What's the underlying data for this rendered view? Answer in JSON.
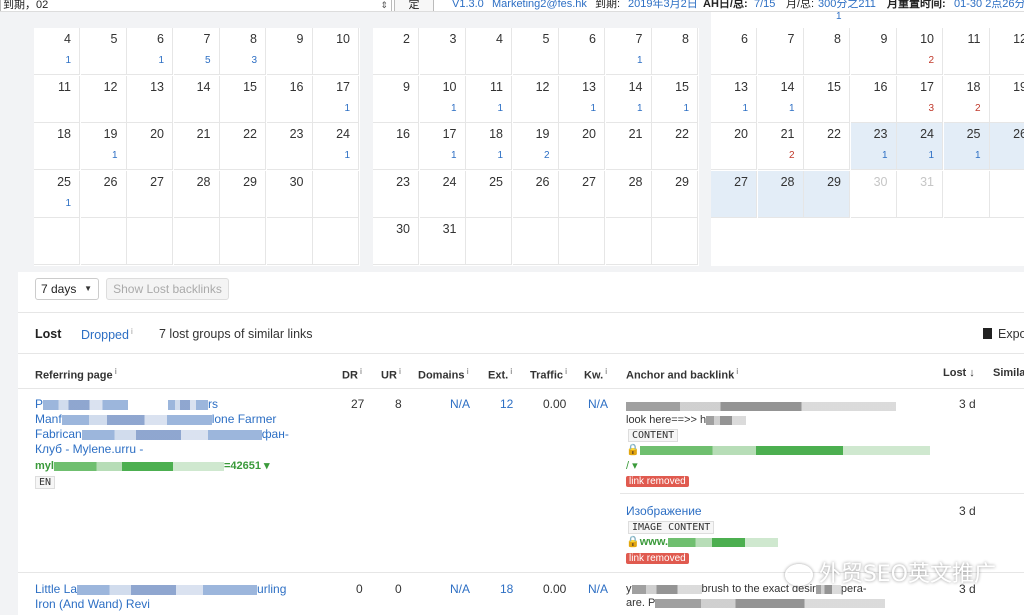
{
  "topbar": {
    "select_value": "到期，02",
    "confirm": "定",
    "version": "V1.3.0",
    "account": "Marketing2@fes.hk",
    "expire_label": "到期:",
    "expire_value": "2019年3月2日",
    "ah_label": "AH日/总:",
    "ah_value": "7/15",
    "month_label": "月/总:",
    "month_value": "300分之211",
    "reset_label": "月重置时间:",
    "reset_value": "01-30 2点26分"
  },
  "cal1": {
    "rows": [
      [
        {
          "d": "4",
          "c": "1"
        },
        {
          "d": "5",
          "c": ""
        },
        {
          "d": "6",
          "c": "1"
        },
        {
          "d": "7",
          "c": "5"
        },
        {
          "d": "8",
          "c": "3"
        },
        {
          "d": "9",
          "c": ""
        },
        {
          "d": "10",
          "c": ""
        }
      ],
      [
        {
          "d": "11",
          "c": ""
        },
        {
          "d": "12",
          "c": ""
        },
        {
          "d": "13",
          "c": ""
        },
        {
          "d": "14",
          "c": ""
        },
        {
          "d": "15",
          "c": ""
        },
        {
          "d": "16",
          "c": ""
        },
        {
          "d": "17",
          "c": "1"
        }
      ],
      [
        {
          "d": "18",
          "c": ""
        },
        {
          "d": "19",
          "c": "1"
        },
        {
          "d": "20",
          "c": ""
        },
        {
          "d": "21",
          "c": ""
        },
        {
          "d": "22",
          "c": ""
        },
        {
          "d": "23",
          "c": ""
        },
        {
          "d": "24",
          "c": "1"
        }
      ],
      [
        {
          "d": "25",
          "c": "1"
        },
        {
          "d": "26",
          "c": ""
        },
        {
          "d": "27",
          "c": ""
        },
        {
          "d": "28",
          "c": ""
        },
        {
          "d": "29",
          "c": ""
        },
        {
          "d": "30",
          "c": ""
        },
        {
          "d": "",
          "c": ""
        }
      ],
      [
        {
          "d": "",
          "c": ""
        },
        {
          "d": "",
          "c": ""
        },
        {
          "d": "",
          "c": ""
        },
        {
          "d": "",
          "c": ""
        },
        {
          "d": "",
          "c": ""
        },
        {
          "d": "",
          "c": ""
        },
        {
          "d": "",
          "c": ""
        }
      ]
    ]
  },
  "cal2": {
    "rows": [
      [
        {
          "d": "2",
          "c": ""
        },
        {
          "d": "3",
          "c": ""
        },
        {
          "d": "4",
          "c": ""
        },
        {
          "d": "5",
          "c": ""
        },
        {
          "d": "6",
          "c": ""
        },
        {
          "d": "7",
          "c": "1"
        },
        {
          "d": "8",
          "c": ""
        }
      ],
      [
        {
          "d": "9",
          "c": ""
        },
        {
          "d": "10",
          "c": "1"
        },
        {
          "d": "11",
          "c": "1"
        },
        {
          "d": "12",
          "c": ""
        },
        {
          "d": "13",
          "c": "1"
        },
        {
          "d": "14",
          "c": "1"
        },
        {
          "d": "15",
          "c": "1"
        }
      ],
      [
        {
          "d": "16",
          "c": ""
        },
        {
          "d": "17",
          "c": "1"
        },
        {
          "d": "18",
          "c": "1"
        },
        {
          "d": "19",
          "c": "2"
        },
        {
          "d": "20",
          "c": ""
        },
        {
          "d": "21",
          "c": ""
        },
        {
          "d": "22",
          "c": ""
        }
      ],
      [
        {
          "d": "23",
          "c": ""
        },
        {
          "d": "24",
          "c": ""
        },
        {
          "d": "25",
          "c": ""
        },
        {
          "d": "26",
          "c": ""
        },
        {
          "d": "27",
          "c": ""
        },
        {
          "d": "28",
          "c": ""
        },
        {
          "d": "29",
          "c": ""
        }
      ],
      [
        {
          "d": "30",
          "c": ""
        },
        {
          "d": "31",
          "c": ""
        },
        {
          "d": "",
          "c": ""
        },
        {
          "d": "",
          "c": ""
        },
        {
          "d": "",
          "c": ""
        },
        {
          "d": "",
          "c": ""
        },
        {
          "d": "",
          "c": ""
        }
      ]
    ]
  },
  "cal3": {
    "top_count": "1",
    "rows": [
      [
        {
          "d": "6",
          "c": ""
        },
        {
          "d": "7",
          "c": ""
        },
        {
          "d": "8",
          "c": ""
        },
        {
          "d": "9",
          "c": ""
        },
        {
          "d": "10",
          "c": "2",
          "red": true
        },
        {
          "d": "11",
          "c": ""
        },
        {
          "d": "12",
          "c": ""
        }
      ],
      [
        {
          "d": "13",
          "c": "1"
        },
        {
          "d": "14",
          "c": "1"
        },
        {
          "d": "15",
          "c": ""
        },
        {
          "d": "16",
          "c": ""
        },
        {
          "d": "17",
          "c": "3",
          "red": true
        },
        {
          "d": "18",
          "c": "2",
          "red": true
        },
        {
          "d": "19",
          "c": ""
        }
      ],
      [
        {
          "d": "20",
          "c": ""
        },
        {
          "d": "21",
          "c": "2",
          "red": true
        },
        {
          "d": "22",
          "c": ""
        },
        {
          "d": "23",
          "c": "1",
          "hl": true
        },
        {
          "d": "24",
          "c": "1",
          "hl": true
        },
        {
          "d": "25",
          "c": "1",
          "hl": true
        },
        {
          "d": "26",
          "c": "",
          "hl": true
        }
      ],
      [
        {
          "d": "27",
          "c": "",
          "hl": true
        },
        {
          "d": "28",
          "c": "",
          "hl": true
        },
        {
          "d": "29",
          "c": "",
          "hl": true
        },
        {
          "d": "30",
          "c": "",
          "dim": true
        },
        {
          "d": "31",
          "c": "",
          "dim": true
        },
        {
          "d": "",
          "c": ""
        },
        {
          "d": "",
          "c": ""
        }
      ]
    ]
  },
  "controls": {
    "range": "7 days",
    "show_lost": "Show Lost backlinks"
  },
  "tabs": {
    "lost": "Lost",
    "dropped": "Dropped",
    "summary": "7 lost groups of similar links",
    "export": "Expo"
  },
  "headers": {
    "ref": "Referring page",
    "dr": "DR",
    "ur": "UR",
    "domains": "Domains",
    "ext": "Ext.",
    "traffic": "Traffic",
    "kw": "Kw.",
    "anchor": "Anchor and backlink",
    "lost": "Lost",
    "similar": "Simila"
  },
  "row1": {
    "title_a": "P",
    "title_b": "rs",
    "title_c": "Manf",
    "title_d": "lone Farmer",
    "title_e": "Fabrican",
    "title_f": "фан-",
    "title_g": "Клуб - Mylene.ur",
    "title_h": "ru -",
    "url_a": "myl",
    "url_b": "=42651 ▾",
    "lang": "EN",
    "dr": "27",
    "ur": "8",
    "domains": "N/A",
    "ext": "12",
    "traffic": "0.00",
    "kw": "N/A",
    "anchor1_a": "styling tools market for development. To know",
    "anchor1_b": "look here==>> h",
    "anchor1_tag": "CONTENT",
    "anchor1_url": "www.... product-category",
    "anchor1_url2": "/ ▾",
    "anchor1_removed": "link removed",
    "lost1": "3 d",
    "anchor2": "Изображение",
    "anchor2_tag": "IMAGE  CONTENT",
    "anchor2_url": "www.",
    "anchor2_removed": "link removed",
    "lost2": "3 d"
  },
  "row2": {
    "title_a": "Little La",
    "title_b": "urling",
    "title_c": "Iron (And Wand) Revi",
    "dr": "0",
    "ur": "0",
    "domains": "N/A",
    "ext": "18",
    "traffic": "0.00",
    "kw": "N/A",
    "anchor_a": "y",
    "anchor_b": "brush to the exact desir",
    "anchor_c": "pera-",
    "anchor_d": "are. P",
    "lost": "3 d"
  },
  "watermark": "外贸SEO英文推广"
}
